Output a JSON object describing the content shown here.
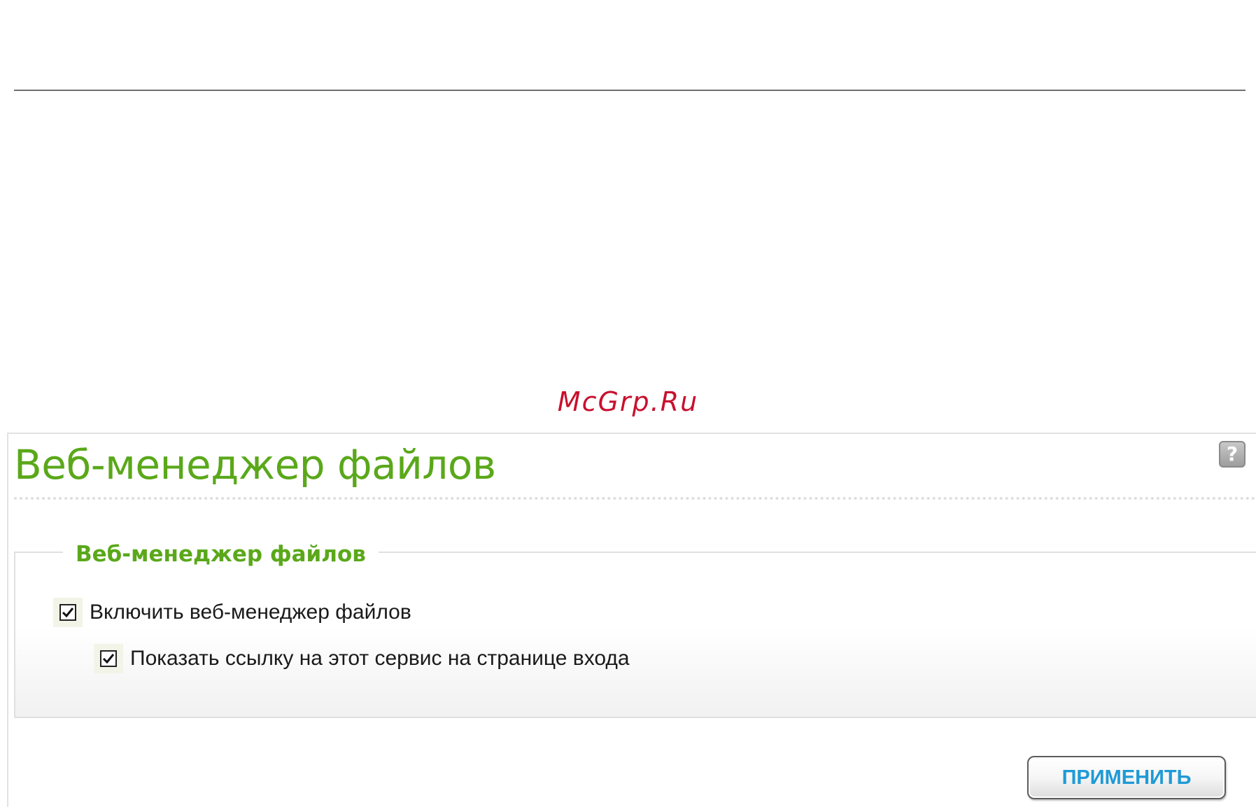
{
  "watermark": {
    "text": "McGrp.Ru"
  },
  "page": {
    "title": "Веб-менеджер файлов",
    "help_icon": "question-mark-icon"
  },
  "section": {
    "legend": "Веб-менеджер файлов",
    "options": [
      {
        "label": "Включить веб-менеджер файлов",
        "checked": true
      },
      {
        "label": "Показать ссылку на этот сервис на странице входа",
        "checked": true
      }
    ]
  },
  "actions": {
    "apply_label": "ПРИМЕНИТЬ"
  },
  "colors": {
    "title_green": "#5aa81a",
    "button_text_blue": "#1f9ad6",
    "watermark_red": "#c8102e"
  }
}
